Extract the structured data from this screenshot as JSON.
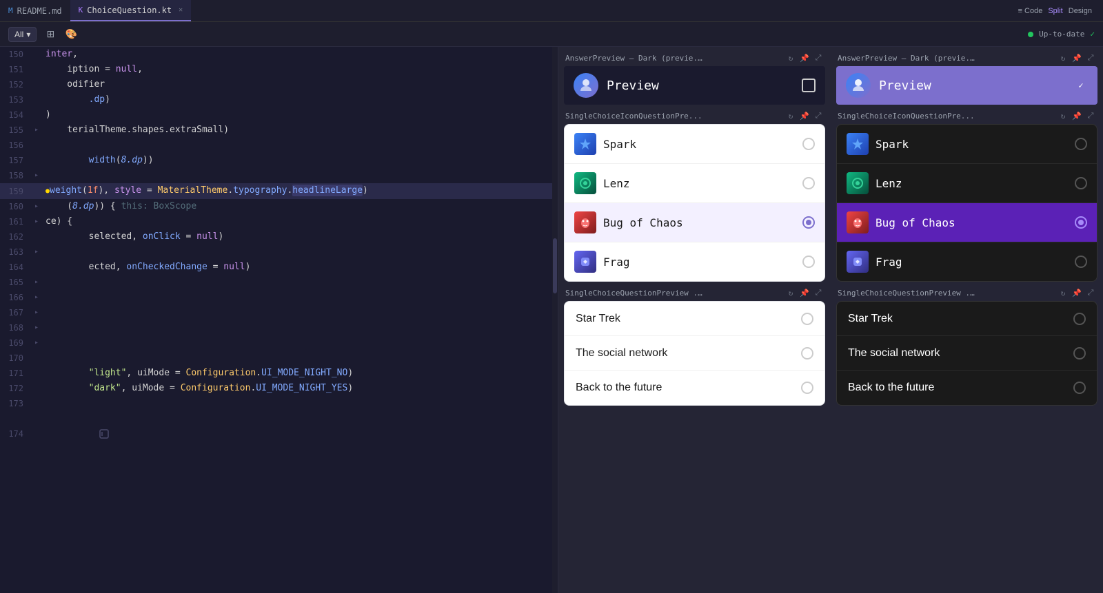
{
  "tabs": [
    {
      "id": "readme",
      "label": "README.md",
      "icon": "md",
      "active": false,
      "modified": false
    },
    {
      "id": "choice",
      "label": "ChoiceQuestion.kt",
      "icon": "kt",
      "active": true,
      "modified": false
    }
  ],
  "toolbar": {
    "code_label": "Code",
    "split_label": "Split",
    "design_label": "Design",
    "status_label": "Up-to-date"
  },
  "sub_toolbar": {
    "all_label": "All",
    "dropdown_arrow": "▾"
  },
  "code_lines": [
    {
      "num": 150,
      "content": "inter,"
    },
    {
      "num": 151,
      "content": "iption = null,"
    },
    {
      "num": 152,
      "content": "odifier"
    },
    {
      "num": 153,
      "content": "    .dp)"
    },
    {
      "num": 154,
      "content": ")"
    },
    {
      "num": 155,
      "content": "terialTheme.shapes.extraSmall)"
    },
    {
      "num": 156,
      "content": ""
    },
    {
      "num": 157,
      "content": "    width(8.dp))"
    },
    {
      "num": 158,
      "content": ""
    },
    {
      "num": 159,
      "content": "weight(1f), style = MaterialTheme.typography.headlineLarge)",
      "highlighted": true,
      "has_dot": true
    },
    {
      "num": 160,
      "content": "    (8.dp)) { this: BoxScope"
    },
    {
      "num": 161,
      "content": "ce) {"
    },
    {
      "num": 162,
      "content": "    selected, onClick = null)"
    },
    {
      "num": 163,
      "content": ""
    },
    {
      "num": 164,
      "content": "    ected, onCheckedChange = null)"
    },
    {
      "num": 165,
      "content": ""
    },
    {
      "num": 166,
      "content": ""
    },
    {
      "num": 167,
      "content": ""
    },
    {
      "num": 168,
      "content": ""
    },
    {
      "num": 169,
      "content": ""
    },
    {
      "num": 170,
      "content": ""
    },
    {
      "num": 171,
      "content": "    \"light\", uiMode = Configuration.UI_MODE_NIGHT_NO)"
    },
    {
      "num": 172,
      "content": "    \"dark\", uiMode = Configuration.UI_MODE_NIGHT_YES)"
    },
    {
      "num": 173,
      "content": ""
    },
    {
      "num": 174,
      "content": ""
    }
  ],
  "preview_panels": {
    "left": {
      "sections": [
        {
          "id": "answer-preview-dark-left",
          "title": "AnswerPreview – Dark (previe...",
          "type": "answer-preview",
          "theme": "dark",
          "label": "Preview",
          "checked": false
        },
        {
          "id": "single-choice-icon-left",
          "title": "SingleChoiceIconQuestionPre...",
          "type": "icon-choice",
          "theme": "light",
          "items": [
            {
              "id": "spark",
              "label": "Spark",
              "selected": false,
              "avatar": "spark"
            },
            {
              "id": "lenz",
              "label": "Lenz",
              "selected": false,
              "avatar": "lenz"
            },
            {
              "id": "bug",
              "label": "Bug of Chaos",
              "selected": true,
              "avatar": "bug"
            },
            {
              "id": "frag",
              "label": "Frag",
              "selected": false,
              "avatar": "frag"
            }
          ]
        },
        {
          "id": "simple-choice-left",
          "title": "SingleChoiceQuestionPreview ...",
          "type": "simple-choice",
          "theme": "light",
          "items": [
            {
              "id": "star-trek",
              "label": "Star Trek",
              "selected": false
            },
            {
              "id": "social-network",
              "label": "The social network",
              "selected": false
            },
            {
              "id": "back-to-future",
              "label": "Back to the future",
              "selected": false
            }
          ]
        }
      ]
    },
    "right": {
      "sections": [
        {
          "id": "answer-preview-dark-right",
          "title": "AnswerPreview – Dark (previe...",
          "type": "answer-preview",
          "theme": "dark-purple",
          "label": "Preview",
          "checked": true
        },
        {
          "id": "single-choice-icon-right",
          "title": "SingleChoiceIconQuestionPre...",
          "type": "icon-choice",
          "theme": "dark",
          "items": [
            {
              "id": "spark",
              "label": "Spark",
              "selected": false,
              "avatar": "spark"
            },
            {
              "id": "lenz",
              "label": "Lenz",
              "selected": false,
              "avatar": "lenz"
            },
            {
              "id": "bug",
              "label": "Bug of Chaos",
              "selected": true,
              "avatar": "bug"
            },
            {
              "id": "frag",
              "label": "Frag",
              "selected": false,
              "avatar": "frag"
            }
          ]
        },
        {
          "id": "simple-choice-right",
          "title": "SingleChoiceQuestionPreview ...",
          "type": "simple-choice",
          "theme": "dark",
          "items": [
            {
              "id": "star-trek",
              "label": "Star Trek",
              "selected": false
            },
            {
              "id": "social-network",
              "label": "The social network",
              "selected": false
            },
            {
              "id": "back-to-future",
              "label": "Back to the future",
              "selected": false
            }
          ]
        }
      ]
    }
  }
}
